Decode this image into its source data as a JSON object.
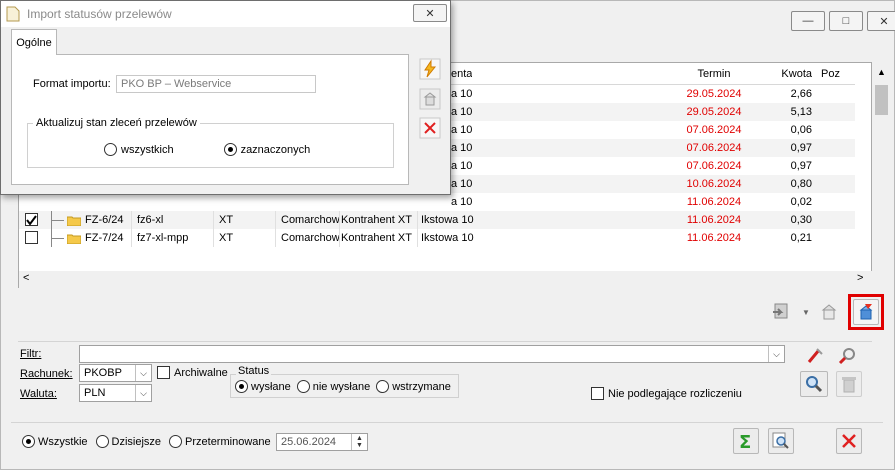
{
  "main": {
    "min_glyph": "—",
    "max_glyph": "□",
    "close_glyph": "✕",
    "columns": {
      "termin": "Termin",
      "kwota": "Kwota",
      "poz": "Poz"
    },
    "hidden_rows": [
      {
        "suffix": "a 10",
        "termin": "29.05.2024",
        "kwota": "2,66"
      },
      {
        "suffix": "a 10",
        "termin": "29.05.2024",
        "kwota": "5,13"
      },
      {
        "suffix": "a 10",
        "termin": "07.06.2024",
        "kwota": "0,06"
      },
      {
        "suffix": "a 10",
        "termin": "07.06.2024",
        "kwota": "0,97"
      },
      {
        "suffix": "a 10",
        "termin": "07.06.2024",
        "kwota": "0,97"
      },
      {
        "suffix": "a 10",
        "termin": "10.06.2024",
        "kwota": "0,80"
      },
      {
        "suffix": "a 10",
        "termin": "11.06.2024",
        "kwota": "0,02"
      }
    ],
    "rows": [
      {
        "checked": true,
        "doc": "FZ-6/24",
        "desc": "fz6-xl",
        "typ": "XT",
        "bank": "Comarchow",
        "kontrahent": "Kontrahent XT",
        "adres": "Ikstowa 10",
        "termin": "11.06.2024",
        "kwota": "0,30"
      },
      {
        "checked": false,
        "doc": "FZ-7/24",
        "desc": "fz7-xl-mpp",
        "typ": "XT",
        "bank": "Comarchow",
        "kontrahent": "Kontrahent XT",
        "adres": "Ikstowa 10",
        "termin": "11.06.2024",
        "kwota": "0,21"
      }
    ],
    "hscroll_left": "<",
    "hscroll_right": ">",
    "filters": {
      "filtr_label": "Filtr:",
      "filtr_value": "",
      "rachunek_label": "Rachunek:",
      "rachunek_value": "PKOBP",
      "archiwalne_label": "Archiwalne",
      "waluta_label": "Waluta:",
      "waluta_value": "PLN",
      "status_title": "Status",
      "status_options": [
        "wysłane",
        "nie wysłane",
        "wstrzymane"
      ],
      "status_selected": 0,
      "nie_podlegajace": "Nie podlegające rozliczeniu"
    },
    "bottom": {
      "options": [
        "Wszystkie",
        "Dzisiejsze",
        "Przeterminowane"
      ],
      "selected": 0,
      "date": "25.06.2024"
    },
    "colors": {
      "red_highlight": "#e00000",
      "date_red": "#e00000"
    }
  },
  "dialog": {
    "title": "Import statusów przelewów",
    "close_glyph": "✕",
    "tab": "Ogólne",
    "format_label": "Format importu:",
    "format_value": "PKO BP – Webservice",
    "group_title": "Aktualizuj stan zleceń przelewów",
    "options": [
      "wszystkich",
      "zaznaczonych"
    ],
    "selected": 1,
    "header_partial": "enta"
  }
}
